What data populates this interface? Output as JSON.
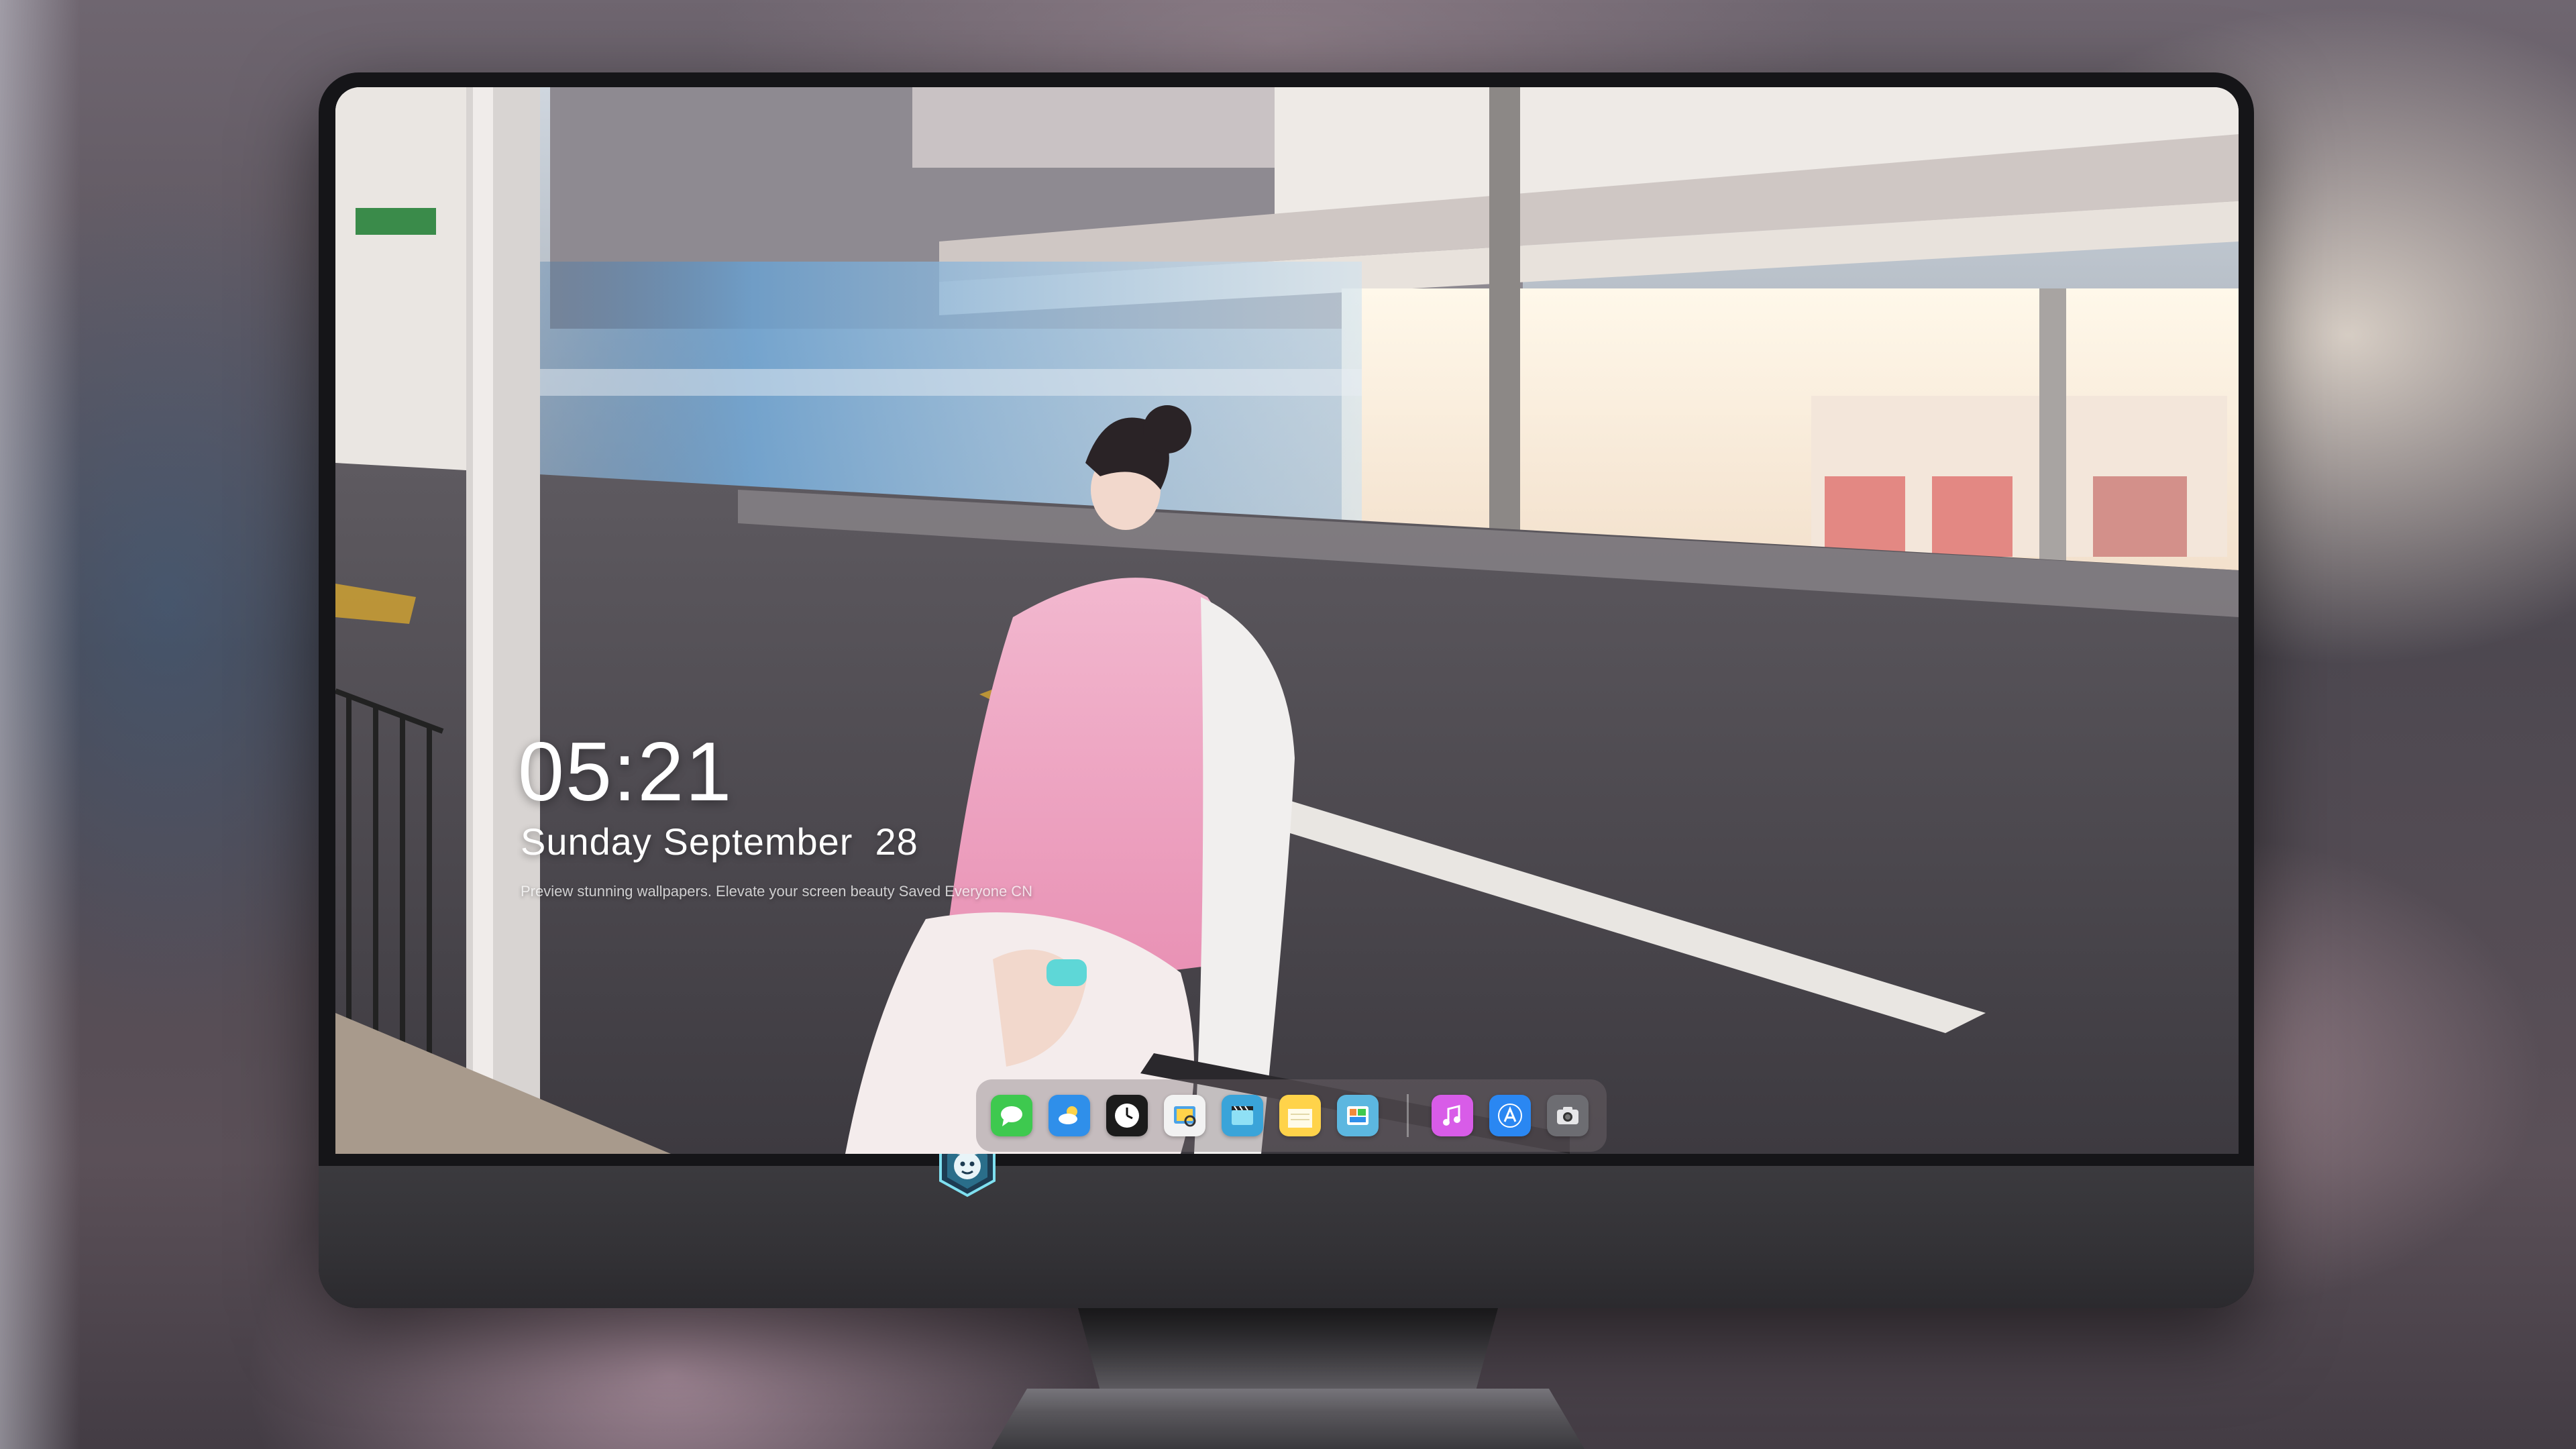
{
  "lock_screen": {
    "time": "05:21",
    "date": "Sunday September  28",
    "tagline": "Preview stunning wallpapers. Elevate your screen beauty   Saved   Everyone CN"
  },
  "dock": {
    "apps": [
      {
        "name": "messages-icon",
        "color": "#3ec94f"
      },
      {
        "name": "weather-icon",
        "color": "#2f8fea"
      },
      {
        "name": "clock-icon",
        "color": "#1b1b1b"
      },
      {
        "name": "preview-icon",
        "color": "#f2f2f2"
      },
      {
        "name": "video-icon",
        "color": "#3aa4d9"
      },
      {
        "name": "notes-icon",
        "color": "#ffd34a"
      },
      {
        "name": "photo-gallery-icon",
        "color": "#5cb7e0"
      },
      {
        "name": "music-icon",
        "color": "#d85ce8"
      },
      {
        "name": "app-store-icon",
        "color": "#2a87f2"
      },
      {
        "name": "camera-icon",
        "color": "#6d6d72"
      }
    ]
  },
  "chin_logo": "dragon-emblem-icon",
  "colors": {
    "bezel": "#151518",
    "chin": "#36353a",
    "text": "#ffffff"
  }
}
